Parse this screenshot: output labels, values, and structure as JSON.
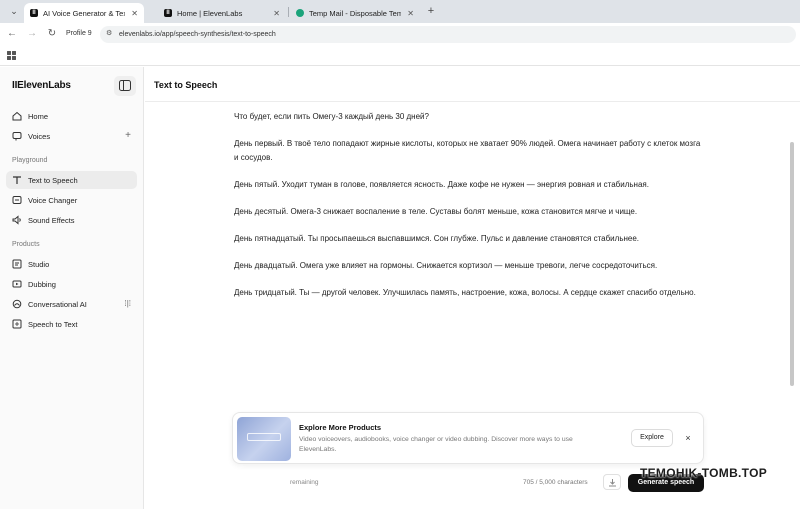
{
  "browser": {
    "tabs": [
      {
        "title": "AI Voice Generator & Text to Sp",
        "icon": "elevenlabs-favicon",
        "active": true
      },
      {
        "title": "Home | ElevenLabs",
        "icon": "elevenlabs-favicon",
        "active": false
      },
      {
        "title": "Temp Mail - Disposable Tempo",
        "icon": "tempmail-favicon",
        "active": false
      }
    ],
    "profile": "Profile 9",
    "url": "elevenlabs.io/app/speech-synthesis/text-to-speech"
  },
  "sidebar": {
    "logo": "IIElevenLabs",
    "top_items": [
      {
        "label": "Home",
        "icon": "home-icon"
      },
      {
        "label": "Voices",
        "icon": "voices-icon"
      }
    ],
    "playground_label": "Playground",
    "playground_items": [
      {
        "label": "Text to Speech",
        "icon": "text-to-speech-icon",
        "active": true
      },
      {
        "label": "Voice Changer",
        "icon": "voice-changer-icon"
      },
      {
        "label": "Sound Effects",
        "icon": "sound-effects-icon"
      }
    ],
    "products_label": "Products",
    "product_items": [
      {
        "label": "Studio",
        "icon": "studio-icon"
      },
      {
        "label": "Dubbing",
        "icon": "dubbing-icon"
      },
      {
        "label": "Conversational AI",
        "icon": "conversational-ai-icon"
      },
      {
        "label": "Speech to Text",
        "icon": "speech-to-text-icon"
      }
    ]
  },
  "main": {
    "title": "Text to Speech",
    "paragraphs": [
      "Что будет, если пить Омегу-3 каждый день 30 дней?",
      "День первый. В твоё тело попадают жирные кислоты, которых не хватает 90% людей. Омега начинает работу с клеток мозга и сосудов.",
      "День пятый. Уходит туман в голове, появляется ясность. Даже кофе не нужен — энергия ровная и стабильная.",
      "День десятый. Омега-3 снижает воспаление в теле. Суставы болят меньше, кожа становится мягче и чище.",
      "День пятнадцатый. Ты просыпаешься выспавшимся. Сон глубже. Пульс и давление становятся стабильнее.",
      "День двадцатый. Омега уже влияет на гормоны. Снижается кортизол — меньше тревоги, легче сосредоточиться.",
      "День тридцатый. Ты — другой человек. Улучшилась память, настроение, кожа, волосы. А сердце скажет спасибо отдельно."
    ]
  },
  "promo": {
    "title": "Explore More Products",
    "description": "Video voiceovers, audiobooks, voice changer or video dubbing. Discover more ways to use ElevenLabs.",
    "button": "Explore",
    "close": "×"
  },
  "footer": {
    "credits": "remaining",
    "char_count": "705 / 5,000 characters",
    "generate": "Generate speech"
  },
  "watermark": "TEMOHIK-TOMB.TOP"
}
